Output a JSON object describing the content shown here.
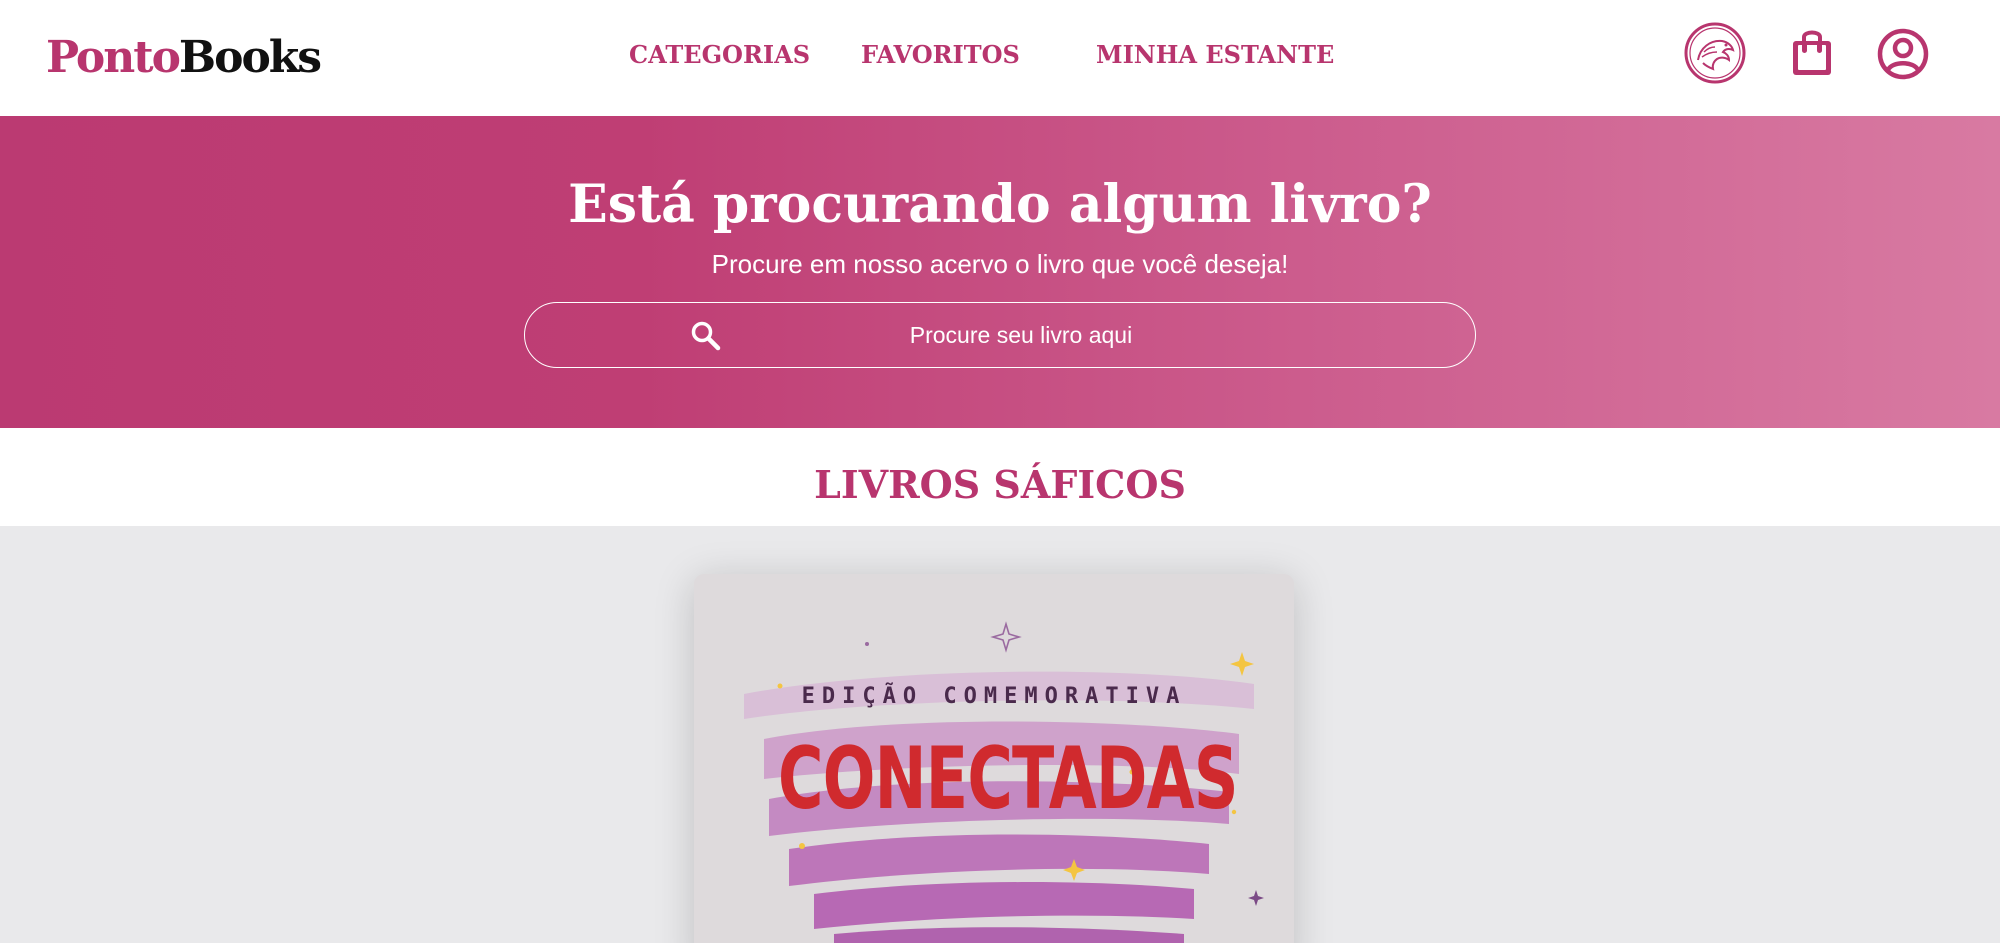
{
  "header": {
    "logo": {
      "part1": "Ponto",
      "part2": "Books"
    },
    "nav": {
      "categories": "CATEGORIAS",
      "favorites": "FAVORITOS",
      "shelf": "MINHA ESTANTE"
    },
    "icons": [
      "dragon-emblem-icon",
      "shopping-bag-icon",
      "user-account-icon"
    ]
  },
  "hero": {
    "title": "Está procurando algum livro?",
    "subtitle": "Procure em nosso acervo o livro que você deseja!",
    "search_placeholder": "Procure seu livro aqui",
    "search_icon": "search-icon"
  },
  "section": {
    "title": "LIVROS SÁFICOS"
  },
  "featured_book": {
    "edition": "EDIÇÃO COMEMORATIVA",
    "title": "CONECTADAS"
  },
  "colors": {
    "brand": "#b8356e",
    "hero_gradient_start": "#bb3a72",
    "hero_gradient_end": "#d87aa2",
    "gallery_bg": "#e9e9eb",
    "book_title": "#d02a2e"
  }
}
